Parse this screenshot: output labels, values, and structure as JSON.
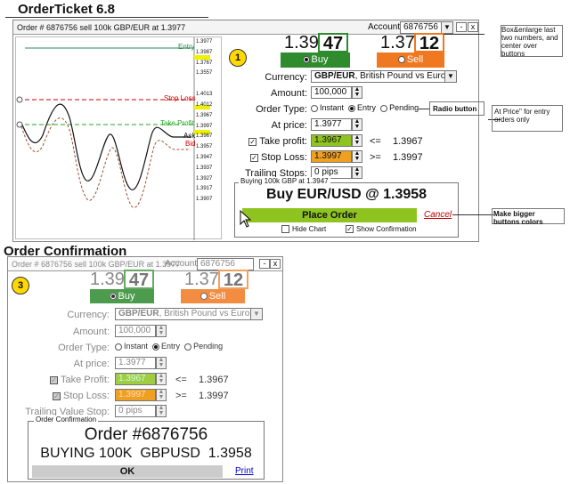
{
  "t1": {
    "title": "OrderTicket 6.8",
    "titlebar": "Order # 6876756  sell 100k  GBP/EUR at 1.3977",
    "account_label": "Account:",
    "account_value": "6876756",
    "buy_big": "1.39",
    "buy_box": "47",
    "sell_big": "1.37",
    "sell_box": "12",
    "buy_label": "Buy",
    "sell_label": "Sell",
    "step": "1",
    "currency_label": "Currency:",
    "currency_bold": "GBP/EUR",
    "currency_rest": ", British Pound vs Euro",
    "amount_label": "Amount:",
    "amount_value": "100,000",
    "order_type_label": "Order Type:",
    "instant": "Instant",
    "entry": "Entry",
    "pending": "Pending",
    "at_price_label": "At price:",
    "at_price_value": "1.3977",
    "take_profit_label": "Take profit:",
    "take_profit_value": "1.3967",
    "tp_op": "<=",
    "tp_ref": "1.3967",
    "stop_loss_label": "Stop Loss:",
    "stop_loss_value": "1.3997",
    "sl_op": ">=",
    "sl_ref": "1.3997",
    "trailing_label": "Trailing Stops:",
    "trailing_value": "0 pips",
    "group_legend": "Buying 100k GBP at 1.3947",
    "summary": "Buy EUR/USD @ 1.3958",
    "place_order": "Place Order",
    "cancel": "Cancel",
    "hide_chart": "Hide Chart",
    "show_confirmation": "Show Confirmation",
    "chart_labels": {
      "entry": "Entry",
      "stop_loss": "Stop Loss",
      "take_profit": "Take Profit",
      "ask": "Ask",
      "bid": "Bid"
    },
    "ticks": [
      "1.3977",
      "1.3987",
      "1.3767",
      "1.3557",
      "1.4013",
      "1.4012",
      "1.3967",
      "1.3997",
      "1.3967",
      "1.3957",
      "1.3947",
      "1.3937",
      "1.3927",
      "1.3917",
      "1.3907"
    ]
  },
  "notes": {
    "box": "Box&enlarge last two numbers, and center over buttons",
    "radio": "Radio button",
    "at_price": "At Price\" for entry orders only",
    "bigger": "Make bigger buttons colors"
  },
  "t2": {
    "title": "Order Confirmation",
    "titlebar": "Order # 6876756  sell 100k  GBP/EUR at 1.3977",
    "account_label": "Account:",
    "account_value": "6876756",
    "buy_big": "1.39",
    "buy_box": "47",
    "sell_big": "1.37",
    "sell_box": "12",
    "buy_label": "Buy",
    "sell_label": "Sell",
    "step": "3",
    "currency_label": "Currency:",
    "currency_bold": "GBP/EUR",
    "currency_rest": ", British Pound vs Euro",
    "amount_label": "Amount:",
    "amount_value": "100,000",
    "order_type_label": "Order Type:",
    "instant": "Instant",
    "entry": "Entry",
    "pending": "Pending",
    "at_price_label": "At price:",
    "at_price_value": "1.3977",
    "take_profit_label": "Take Profit:",
    "take_profit_value": "1.3967",
    "tp_op": "<=",
    "tp_ref": "1.3967",
    "stop_loss_label": "Stop Loss:",
    "stop_loss_value": "1.3997",
    "sl_op": ">=",
    "sl_ref": "1.3997",
    "trailing_label": "Trailing Value Stop:",
    "trailing_value": "0 pips",
    "group_legend": "Order Confirmation",
    "order_no": "Order #6876756",
    "buying": "BUYING 100K  GBPUSD  1.3958",
    "ok": "OK",
    "print": "Print"
  },
  "colors": {
    "buy": "#2e8b2e",
    "sell": "#f07820",
    "tp": "#8fc31f",
    "sl": "#f0a020",
    "place": "#8fc31f",
    "cancel": "#c00000"
  }
}
